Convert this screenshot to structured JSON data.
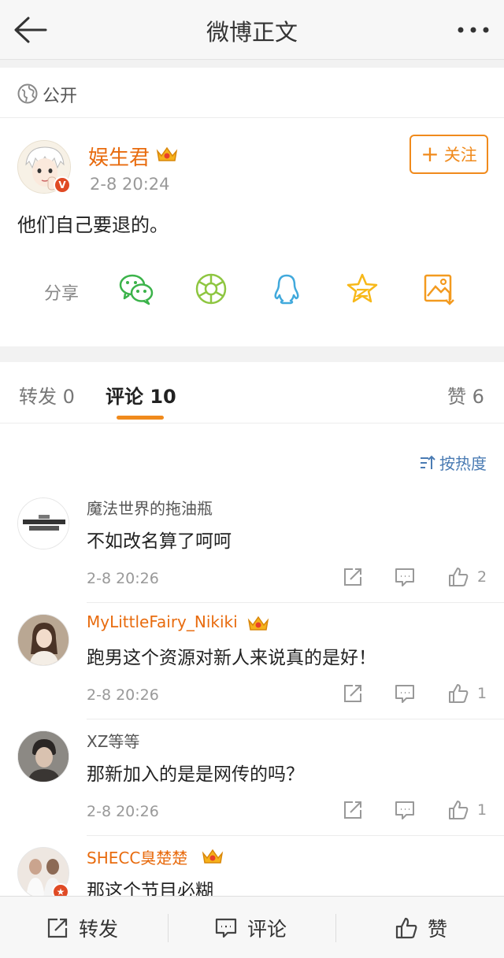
{
  "nav": {
    "title": "微博正文"
  },
  "visibility": {
    "label": "公开",
    "icon": "globe-icon"
  },
  "post": {
    "author": "娱生君",
    "time": "2-8 20:24",
    "follow_label": "关注",
    "text": "他们自己要退的。",
    "verified_badge": "V",
    "share_label": "分享",
    "share_targets": [
      "wechat-icon",
      "moments-icon",
      "qq-icon",
      "qzone-icon",
      "save-image-icon"
    ]
  },
  "tabs": {
    "repost": "转发 0",
    "comments": "评论 10",
    "likes": "赞 6"
  },
  "sort": {
    "label": "按热度"
  },
  "comments": [
    {
      "author": "魔法世界的拖油瓶",
      "text": "不如改名算了呵呵",
      "time": "2-8 20:26",
      "likes": "2",
      "vip": false
    },
    {
      "author": "MyLittleFairy_Nikiki",
      "text": "跑男这个资源对新人来说真的是好！",
      "time": "2-8 20:26",
      "likes": "1",
      "vip": true
    },
    {
      "author": "XZ等等",
      "text": "那新加入的是是网传的吗？",
      "time": "2-8 20:26",
      "likes": "1",
      "vip": false
    },
    {
      "author": "SHECC臭楚楚",
      "text": "那这个节目必糊",
      "time": "",
      "likes": "",
      "vip": true
    }
  ],
  "bottom_bar": {
    "repost": "转发",
    "comment": "评论",
    "like": "赞"
  },
  "colors": {
    "accent": "#f08a1c",
    "vip_name": "#e86b0e",
    "link": "#4a7bb3"
  }
}
